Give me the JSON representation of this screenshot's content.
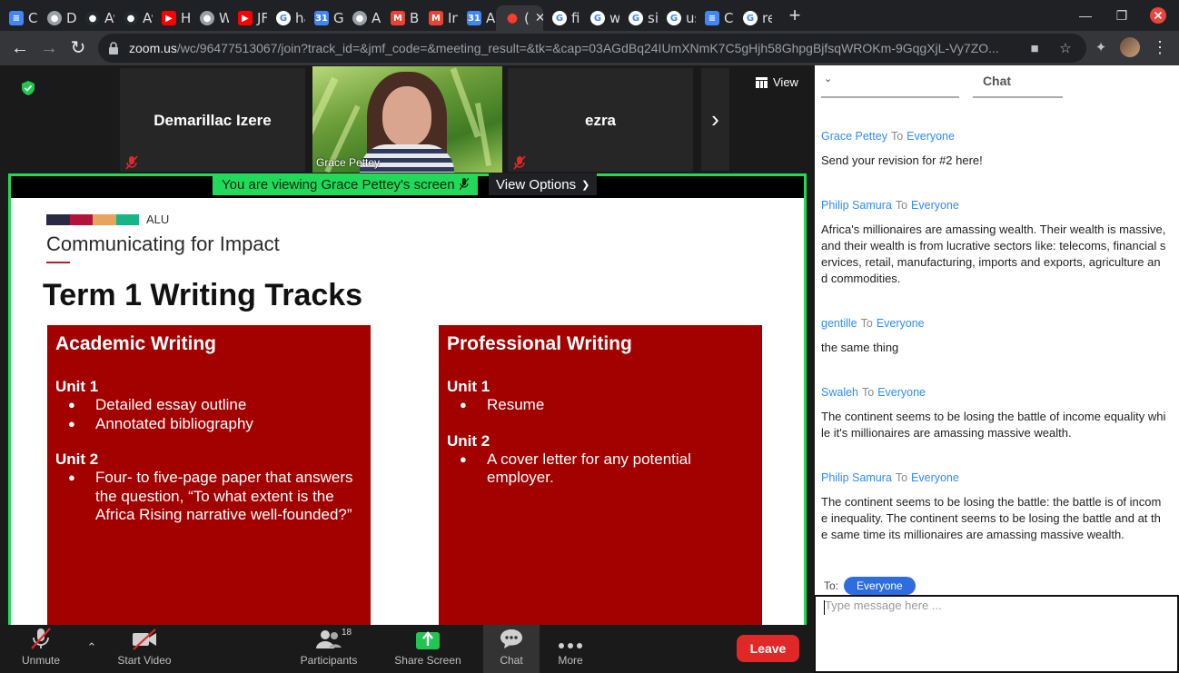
{
  "browser": {
    "tabs": [
      {
        "title": "Ch",
        "icon": "docs-icon",
        "color": "#4285f4"
      },
      {
        "title": "De",
        "icon": "globe-icon",
        "color": "#9aa0a6"
      },
      {
        "title": "Av",
        "icon": "github-icon",
        "color": "#24292e"
      },
      {
        "title": "Av",
        "icon": "github-icon",
        "color": "#24292e"
      },
      {
        "title": "Hc",
        "icon": "youtube-icon",
        "color": "#ff0000"
      },
      {
        "title": "W",
        "icon": "globe-icon",
        "color": "#9aa0a6"
      },
      {
        "title": "JF",
        "icon": "youtube-icon",
        "color": "#ff0000"
      },
      {
        "title": "ha",
        "icon": "google-icon",
        "color": "#ffffff"
      },
      {
        "title": "Gc",
        "icon": "calendar-icon",
        "color": "#4285f4"
      },
      {
        "title": "Al",
        "icon": "globe-icon",
        "color": "#9aa0a6"
      },
      {
        "title": "Bc",
        "icon": "gmail-icon",
        "color": "#ea4335"
      },
      {
        "title": "In",
        "icon": "gmail-icon",
        "color": "#ea4335"
      },
      {
        "title": "Al",
        "icon": "calendar-icon",
        "color": "#4285f4"
      },
      {
        "title": "(",
        "icon": "zoom-recording-icon",
        "color": "#ff3b30",
        "active": true
      },
      {
        "title": "fi",
        "icon": "google-icon",
        "color": "#ffffff"
      },
      {
        "title": "wl",
        "icon": "google-icon",
        "color": "#ffffff"
      },
      {
        "title": "si",
        "icon": "google-icon",
        "color": "#ffffff"
      },
      {
        "title": "us",
        "icon": "google-icon",
        "color": "#ffffff"
      },
      {
        "title": "Co",
        "icon": "docs-icon",
        "color": "#4285f4"
      },
      {
        "title": "re",
        "icon": "google-icon",
        "color": "#ffffff"
      }
    ],
    "url_host": "zoom.us",
    "url_path": "/wc/96477513067/join?track_id=&jmf_code=&meeting_result=&tk=&cap=03AGdBq24IUmXNmK7C5gHjh58GhpgBjfsqWROKm-9GqgXjL-Vy7ZO..."
  },
  "meeting": {
    "participants_top": [
      {
        "name": "Demarillac Izere",
        "muted": true
      },
      {
        "name": "Grace Pettey",
        "video": true
      },
      {
        "name": "ezra",
        "muted": true
      }
    ],
    "view_label": "View",
    "share_banner": "You are viewing Grace Pettey's screen",
    "view_options_label": "View Options"
  },
  "slide": {
    "logo_colors": [
      "#2b2a44",
      "#b3123a",
      "#e8a45c",
      "#16b585"
    ],
    "logo_text": "ALU",
    "course_title": "Communicating for Impact",
    "heading": "Term 1 Writing Tracks",
    "left_box": {
      "title": "Academic Writing",
      "unit1": "Unit 1",
      "unit1_items": [
        "Detailed essay outline",
        "Annotated bibliography"
      ],
      "unit2": "Unit 2",
      "unit2_items": [
        "Four- to five-page paper that answers the question, “To what extent is the Africa Rising narrative well-founded?”"
      ]
    },
    "right_box": {
      "title": "Professional Writing",
      "unit1": "Unit 1",
      "unit1_items": [
        "Resume"
      ],
      "unit2": "Unit 2",
      "unit2_items": [
        "A cover letter for any potential employer."
      ]
    }
  },
  "controls": {
    "unmute": "Unmute",
    "start_video": "Start Video",
    "participants": "Participants",
    "participants_count": "18",
    "share_screen": "Share Screen",
    "chat": "Chat",
    "more": "More",
    "leave": "Leave"
  },
  "chat": {
    "title": "Chat",
    "to_label": "To",
    "messages": [
      {
        "sender": "Grace Pettey",
        "recipient": "Everyone",
        "text": "Send your revision for #2 here!"
      },
      {
        "sender": "Philip Samura",
        "recipient": "Everyone",
        "text": "Africa's millionaires are amassing wealth. Their wealth is massive, and their wealth is from lucrative sectors like: telecoms, financial services, retail, manufacturing, imports and exports, agriculture and commodities."
      },
      {
        "sender": "gentille",
        "recipient": "Everyone",
        "text": "the same thing"
      },
      {
        "sender": "Swaleh",
        "recipient": "Everyone",
        "text": "The continent seems to be losing the battle of income equality while it's millionaires are amassing massive wealth."
      },
      {
        "sender": "Philip Samura",
        "recipient": "Everyone",
        "text": "The continent seems to be losing the battle: the battle is of income inequality. The continent seems to be losing the battle and at the same time  its millionaires are amassing massive wealth."
      }
    ],
    "send_to_label": "To:",
    "send_to_value": "Everyone",
    "input_placeholder": "Type message here ..."
  }
}
